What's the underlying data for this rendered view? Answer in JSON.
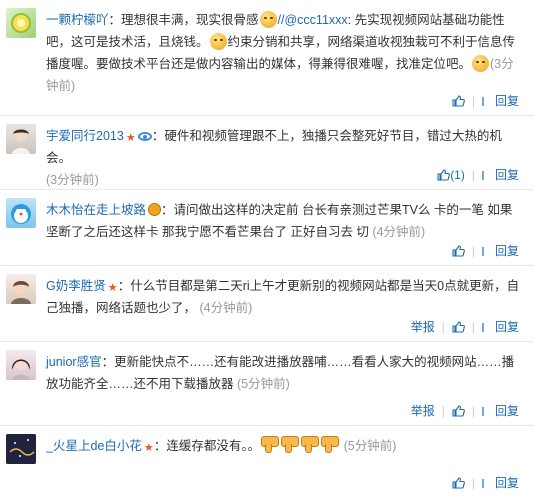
{
  "comments": [
    {
      "user": "一颗柠檬吖",
      "text_a": "：理想很丰满，现实很骨感",
      "mention": "//@ccc11xxx",
      "text_b": ": 先实现视频网站基础功能性吧，这可是技术活，且烧钱。",
      "text_c": "约束分销和共享，网络渠道收视独栽可不利于信息传播度喔。要做技术平台还是做内容输出的媒体，得兼得很难喔，找准定位吧。",
      "time": "(3分钟前)",
      "reply": "回复"
    },
    {
      "user": "宇爱同行2013",
      "text": "：硬件和视频管理跟不上，独播只会整死好节目，错过大热的机会。",
      "time": "(3分钟前)",
      "likes": "(1)",
      "reply": "回复"
    },
    {
      "user": "木木怡在走上坡路",
      "text": "：请问做出这样的决定前 台长有亲测过芒果TV么 卡的一笔 如果坚断了之后还这样卡 那我宁愿不看芒果台了 正好自习去 切",
      "time": "(4分钟前)",
      "reply": "回复"
    },
    {
      "user": "G奶李胜贤",
      "text": "：什么节目都是第二天ri上午才更新别的视频网站都是当天0点就更新，自己独播，网络话题也少了，",
      "time": "(4分钟前)",
      "report": "举报",
      "reply": "回复"
    },
    {
      "user": "junior感官",
      "text": "：更新能快点不……还有能改进播放器哺……看看人家大的视频网站……播放功能齐全……还不用下载播放器",
      "time": "(5分钟前)",
      "report": "举报",
      "reply": "回复"
    },
    {
      "user": "_火星上de白小花",
      "text": "：连缓存都没有。。",
      "time": "(5分钟前)",
      "reply": "回复"
    }
  ]
}
